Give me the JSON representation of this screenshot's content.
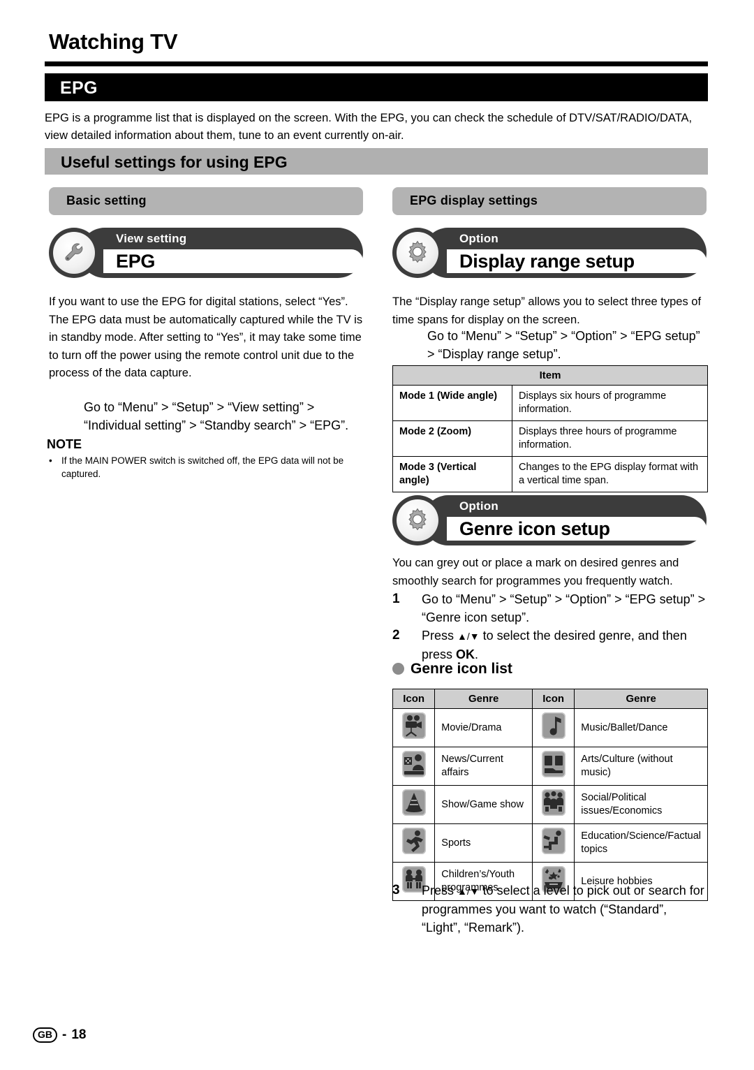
{
  "header": {
    "page_title": "Watching TV",
    "section_bar": "EPG",
    "intro": "EPG is a programme list that is displayed on the screen. With the EPG, you can check the schedule of DTV/SAT/RADIO/DATA, view detailed information about them, tune to an event currently on-air.",
    "banner": "Useful settings for using EPG"
  },
  "left": {
    "sub_banner": "Basic setting",
    "capsule": {
      "category": "View setting",
      "name": "EPG",
      "icon": "wrench-icon"
    },
    "body": "If you want to use the EPG for digital stations, select “Yes”. The EPG data must be automatically captured while the TV is in standby mode. After setting to “Yes”, it may take some time to turn off the power using the remote control unit due to the process of the data capture.",
    "go_to": "Go to “Menu” > “Setup” > “View setting” > “Individual setting” > “Standby search” > “EPG”.",
    "note_heading": "NOTE",
    "note_bullet": "•",
    "note_text": "If the MAIN POWER switch is switched off, the EPG data will not be captured."
  },
  "right": {
    "sub_banner": "EPG display settings",
    "display_range": {
      "capsule": {
        "category": "Option",
        "name": "Display range setup",
        "icon": "gear-icon"
      },
      "body": "The “Display range setup” allows you to select three types of time spans for display on the screen.",
      "go_to": "Go to “Menu” > “Setup” > “Option” > “EPG setup” > “Display range setup”."
    },
    "item_table": {
      "header": "Item",
      "rows": [
        {
          "item": "Mode 1 (Wide angle)",
          "desc": "Displays six hours of programme information."
        },
        {
          "item": "Mode 2 (Zoom)",
          "desc": "Displays three hours of programme information."
        },
        {
          "item": "Mode 3 (Vertical angle)",
          "desc": "Changes to the EPG display format with a vertical time span."
        }
      ]
    },
    "genre_setup": {
      "capsule": {
        "category": "Option",
        "name": "Genre icon setup",
        "icon": "gear-icon"
      },
      "body": "You can grey out or place a mark on desired genres and smoothly search for programmes you frequently watch.",
      "steps": [
        {
          "num": "1",
          "text": "Go to “Menu” > “Setup” > “Option” > “EPG setup” > “Genre icon setup”."
        },
        {
          "num": "2",
          "pre": "Press ",
          "keys": "▲/▼",
          "mid": " to select the desired genre, and then press ",
          "key2": "OK",
          "post": "."
        },
        {
          "num": "3",
          "pre": "Press ",
          "keys": "▲/▼",
          "mid": " to select a level to pick out or search for programmes you want to watch (“Standard”, “Light”, “Remark”).",
          "key2": "",
          "post": ""
        }
      ],
      "list_heading": "Genre icon list"
    },
    "genre_table": {
      "headers": [
        "Icon",
        "Genre",
        "Icon",
        "Genre"
      ],
      "rows": [
        {
          "icon_left": "movie-camera-icon",
          "genre_left": "Movie/Drama",
          "icon_right": "music-note-icon",
          "genre_right": "Music/Ballet/Dance"
        },
        {
          "icon_left": "news-anchor-icon",
          "genre_left": "News/Current affairs",
          "icon_right": "open-book-icon",
          "genre_right": "Arts/Culture (without music)"
        },
        {
          "icon_left": "game-show-icon",
          "genre_left": "Show/Game show",
          "icon_right": "people-group-icon",
          "genre_right": "Social/Political issues/Economics"
        },
        {
          "icon_left": "running-figure-icon",
          "genre_left": "Sports",
          "icon_right": "education-icon",
          "genre_right": "Education/Science/Factual topics"
        },
        {
          "icon_left": "children-icon",
          "genre_left": "Children’s/Youth programmes",
          "icon_right": "hobbies-icon",
          "genre_right": "Leisure hobbies"
        }
      ]
    }
  },
  "footer": {
    "region": "GB",
    "separator": "-",
    "page_number": "18"
  },
  "colors": {
    "bar_black": "#000000",
    "banner_gray": "#b0b0b0",
    "sub_banner_gray": "#b3b3b3",
    "capsule_dark": "#3c3c3c",
    "table_header_gray": "#cfcfcf",
    "icon_tile_gray": "#9a9a9a"
  }
}
